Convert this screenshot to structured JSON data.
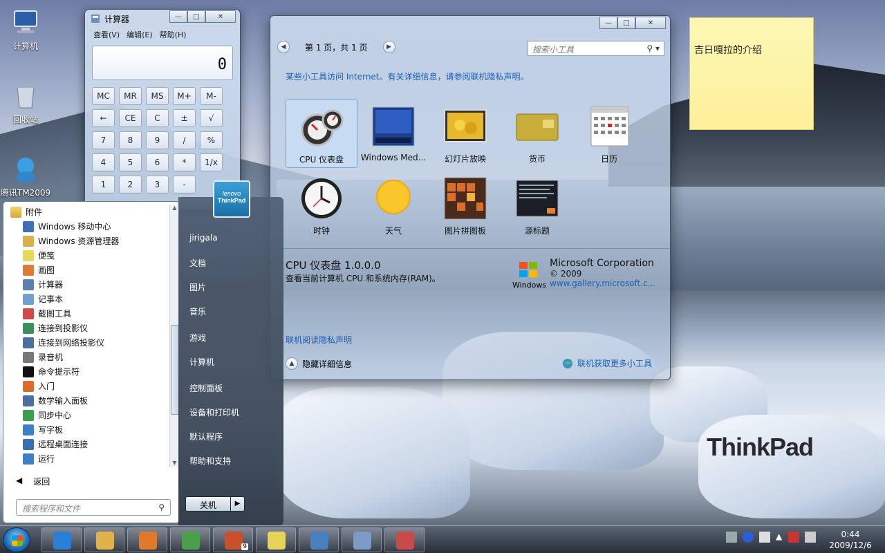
{
  "desktop": {
    "icons": [
      {
        "label": "计算机",
        "icon": "computer-icon"
      },
      {
        "label": "回收站",
        "icon": "recycle-bin-icon"
      },
      {
        "label": "腾讯TM2009",
        "icon": "qq-tm-icon"
      }
    ],
    "watermark": "ThinkPad"
  },
  "calculator": {
    "title": "计算器",
    "menu": [
      "查看(V)",
      "编辑(E)",
      "帮助(H)"
    ],
    "display": "0",
    "keys": [
      "MC",
      "MR",
      "MS",
      "M+",
      "M-",
      "←",
      "CE",
      "C",
      "±",
      "√",
      "7",
      "8",
      "9",
      "/",
      "%",
      "4",
      "5",
      "6",
      "*",
      "1/x",
      "1",
      "2",
      "3",
      "-",
      ""
    ]
  },
  "gallery": {
    "page_text": "第 1 页，共 1 页",
    "search_placeholder": "搜索小工具",
    "notice": "某些小工具访问 Internet。有关详细信息，请参阅联机隐私声明。",
    "items": [
      {
        "label": "CPU 仪表盘",
        "icon": "cpu-meter-icon",
        "selected": true
      },
      {
        "label": "Windows Med...",
        "icon": "media-center-icon",
        "selected": false
      },
      {
        "label": "幻灯片放映",
        "icon": "slideshow-icon",
        "selected": false
      },
      {
        "label": "货币",
        "icon": "currency-icon",
        "selected": false
      },
      {
        "label": "日历",
        "icon": "calendar-icon",
        "selected": false
      },
      {
        "label": "时钟",
        "icon": "clock-icon",
        "selected": false
      },
      {
        "label": "天气",
        "icon": "weather-icon",
        "selected": false
      },
      {
        "label": "图片拼图板",
        "icon": "puzzle-icon",
        "selected": false
      },
      {
        "label": "源标题",
        "icon": "feed-headlines-icon",
        "selected": false
      }
    ],
    "detail": {
      "title": "CPU 仪表盘 1.0.0.0",
      "description": "查看当前计算机 CPU 和系统内存(RAM)。",
      "publisher": "Microsoft Corporation",
      "copyright": "© 2009",
      "link": "www.gallery.microsoft.c...",
      "windows_logo_text": "Windows"
    },
    "privacy_link": "联机阅读隐私声明",
    "hide_details": "隐藏详细信息",
    "more_gadgets": "联机获取更多小工具"
  },
  "sticky_note": {
    "text": "吉日嘎拉的介绍"
  },
  "start_menu": {
    "folder": "附件",
    "programs": [
      {
        "label": "Windows 移动中心",
        "color": "#3f6fb5"
      },
      {
        "label": "Windows 资源管理器",
        "color": "#d9b14a"
      },
      {
        "label": "便笺",
        "color": "#e8d85a"
      },
      {
        "label": "画图",
        "color": "#e07b39"
      },
      {
        "label": "计算器",
        "color": "#5a7fb0"
      },
      {
        "label": "记事本",
        "color": "#6fa0d0"
      },
      {
        "label": "截图工具",
        "color": "#d04a4a"
      },
      {
        "label": "连接到投影仪",
        "color": "#3a8f5a"
      },
      {
        "label": "连接到网络投影仪",
        "color": "#4f6f9f"
      },
      {
        "label": "录音机",
        "color": "#777777"
      },
      {
        "label": "命令提示符",
        "color": "#111111"
      },
      {
        "label": "入门",
        "color": "#e06a2a"
      },
      {
        "label": "数学输入面板",
        "color": "#4a6fa0"
      },
      {
        "label": "同步中心",
        "color": "#3aa04a"
      },
      {
        "label": "写字板",
        "color": "#3f7fc5"
      },
      {
        "label": "远程桌面连接",
        "color": "#3a6fb0"
      },
      {
        "label": "运行",
        "color": "#3f7fc5"
      }
    ],
    "back": "返回",
    "search_placeholder": "搜索程序和文件",
    "user_pic_text": [
      "lenovo",
      "ThinkPad"
    ],
    "right_links": [
      "jirigala",
      "文档",
      "图片",
      "音乐",
      "游戏",
      "计算机",
      "控制面板",
      "设备和打印机",
      "默认程序",
      "帮助和支持"
    ],
    "shutdown": "关机"
  },
  "taskbar": {
    "buttons": [
      {
        "name": "ie-icon",
        "color": "#2a7fd6"
      },
      {
        "name": "explorer-icon",
        "color": "#e0b24a"
      },
      {
        "name": "media-player-icon",
        "color": "#e07a2a"
      },
      {
        "name": "msn-icon",
        "color": "#4aa04a"
      },
      {
        "name": "paint-icon",
        "color": "#c8502a"
      },
      {
        "name": "sticky-notes-icon",
        "color": "#e6d45a"
      },
      {
        "name": "gadgets-icon",
        "color": "#4a7fc0"
      },
      {
        "name": "calculator-icon",
        "color": "#7a9ac8"
      },
      {
        "name": "snipping-tool-icon",
        "color": "#c84a4a"
      }
    ],
    "badge": "9",
    "time": "0:44",
    "date": "2009/12/6"
  }
}
